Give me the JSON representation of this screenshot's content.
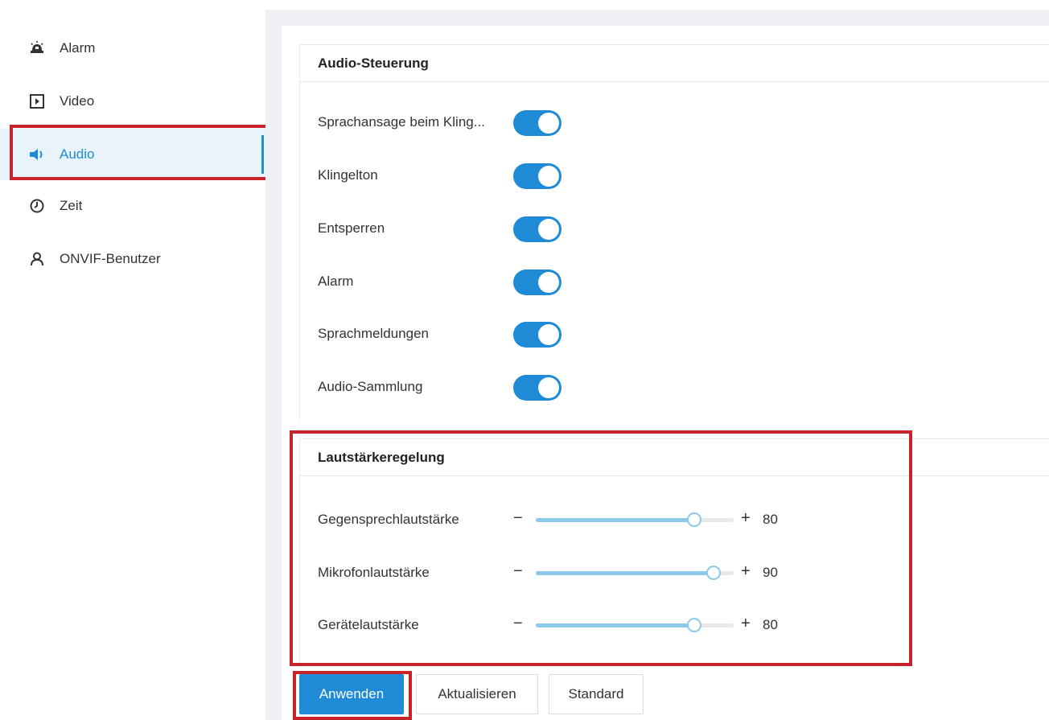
{
  "sidebar": {
    "items": [
      {
        "label": "Alarm",
        "icon": "alarm-bell-icon"
      },
      {
        "label": "Video",
        "icon": "video-play-icon"
      },
      {
        "label": "Audio",
        "icon": "speaker-icon",
        "active": true
      },
      {
        "label": "Zeit",
        "icon": "clock-icon"
      },
      {
        "label": "ONVIF-Benutzer",
        "icon": "user-icon"
      }
    ]
  },
  "audio_control": {
    "title": "Audio-Steuerung",
    "toggles": [
      {
        "label": "Sprachansage beim Kling...",
        "on": true
      },
      {
        "label": "Klingelton",
        "on": true
      },
      {
        "label": "Entsperren",
        "on": true
      },
      {
        "label": "Alarm",
        "on": true
      },
      {
        "label": "Sprachmeldungen",
        "on": true
      },
      {
        "label": "Audio-Sammlung",
        "on": true
      }
    ]
  },
  "volume_control": {
    "title": "Lautstärkeregelung",
    "sliders": [
      {
        "label": "Gegensprechlautstärke",
        "value": "80",
        "minus": "−",
        "plus": "+"
      },
      {
        "label": "Mikrofonlautstärke",
        "value": "90",
        "minus": "−",
        "plus": "+"
      },
      {
        "label": "Gerätelautstärke",
        "value": "80",
        "minus": "−",
        "plus": "+"
      }
    ]
  },
  "buttons": {
    "apply": "Anwenden",
    "refresh": "Aktualisieren",
    "default": "Standard"
  },
  "colors": {
    "accent": "#1f8ad6",
    "highlight_box": "#c8232b",
    "slider_fill": "#8cc8ec"
  }
}
